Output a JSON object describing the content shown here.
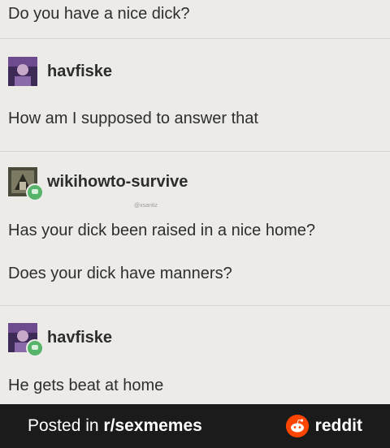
{
  "thread": {
    "question": "Do you have a nice dick?",
    "posts": [
      {
        "username": "havfiske",
        "lines": [
          "How am I supposed to answer that"
        ]
      },
      {
        "username": "wikihowto-survive",
        "source_note": "@xsantiz",
        "lines": [
          "Has your dick been raised in a nice home?",
          "Does your dick have manners?"
        ]
      },
      {
        "username": "havfiske",
        "lines": [
          "He gets beat at home"
        ]
      }
    ]
  },
  "footer": {
    "posted_prefix": "Posted in ",
    "subreddit": "r/sexmemes",
    "brand": "reddit"
  },
  "colors": {
    "background": "#ecebe8",
    "footer_bar": "#1b1b1b",
    "reddit_orange": "#ff4500",
    "badge_green": "#56b36a"
  },
  "icons": [
    "avatar-havfiske",
    "avatar-wikihowto-survive",
    "reddit-logo-icon"
  ]
}
